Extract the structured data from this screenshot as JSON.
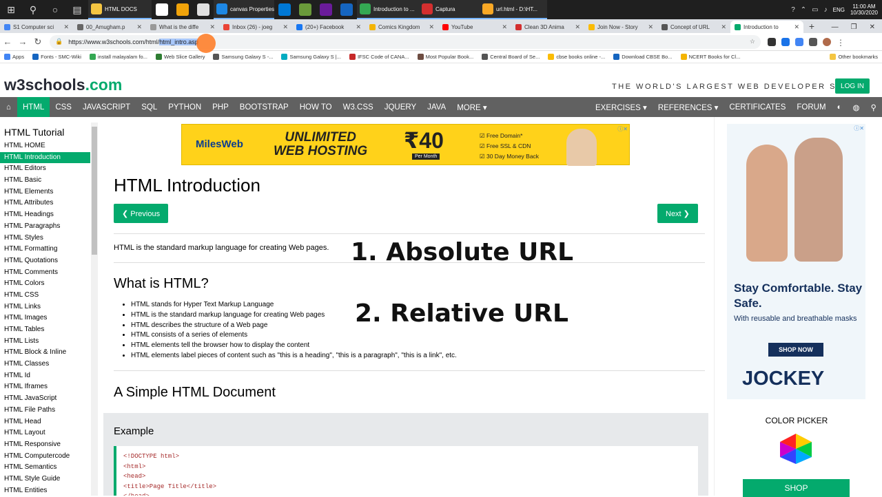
{
  "taskbar": {
    "apps": [
      {
        "label": "HTML DOCS",
        "color": "#f4c542",
        "open": true
      },
      {
        "label": "canvas Properties",
        "color": "#1e88e5",
        "open": true
      },
      {
        "label": "Introduction to ...",
        "color": "#34a853",
        "open": true
      },
      {
        "label": "Captura",
        "color": "#d32f2f",
        "open": true
      },
      {
        "label": "url.html - D:\\HT...",
        "color": "#f9a825",
        "open": true
      }
    ],
    "badge": "99+",
    "lang": "ENG",
    "time": "11:00 AM",
    "date": "10/30/2020"
  },
  "tabs": [
    {
      "title": "S1 Computer sci",
      "color": "#4285f4"
    },
    {
      "title": "00_Amugham.p",
      "color": "#666"
    },
    {
      "title": "What is the diffe",
      "color": "#999"
    },
    {
      "title": "Inbox (26) - joeg",
      "color": "#ea4335"
    },
    {
      "title": "(20+) Facebook",
      "color": "#1877f2"
    },
    {
      "title": "Comics Kingdom",
      "color": "#f4b400"
    },
    {
      "title": "YouTube",
      "color": "#ff0000"
    },
    {
      "title": "Clean 3D Anima",
      "color": "#d32f2f"
    },
    {
      "title": "Join Now - Story",
      "color": "#fbbc05"
    },
    {
      "title": "Concept of URL",
      "color": "#555"
    },
    {
      "title": "Introduction to",
      "color": "#04AA6D",
      "active": true
    }
  ],
  "address": {
    "prefix": "https://www.w3schools.com/html/",
    "selected": "html_intro.asp"
  },
  "bookmarks": [
    {
      "label": "Apps",
      "color": "#4285f4"
    },
    {
      "label": "Fonts - SMC-Wiki",
      "color": "#1565c0"
    },
    {
      "label": "install malayalam fo...",
      "color": "#34a853"
    },
    {
      "label": "Web Slice Gallery",
      "color": "#2e7d32"
    },
    {
      "label": "Samsung Galaxy S -...",
      "color": "#555"
    },
    {
      "label": "Samsung Galaxy S |...",
      "color": "#00acc1"
    },
    {
      "label": "IFSC Code of CANA...",
      "color": "#c62828"
    },
    {
      "label": "Most Popular Book...",
      "color": "#6d4c41"
    },
    {
      "label": "Central Board of Se...",
      "color": "#555"
    },
    {
      "label": "cbse books online -...",
      "color": "#fbbc05"
    },
    {
      "label": "Download CBSE Bo...",
      "color": "#1565c0"
    },
    {
      "label": "NCERT Books for Cl...",
      "color": "#f4b400"
    },
    {
      "label": "Other bookmarks",
      "color": "#f4c542"
    }
  ],
  "site": {
    "logo_main": "w3schools",
    "logo_tld": ".com",
    "tagline": "THE WORLD'S LARGEST WEB DEVELOPER SITE",
    "login": "LOG IN",
    "nav": [
      "HTML",
      "CSS",
      "JAVASCRIPT",
      "SQL",
      "PYTHON",
      "PHP",
      "BOOTSTRAP",
      "HOW TO",
      "W3.CSS",
      "JQUERY",
      "JAVA",
      "MORE ▾"
    ],
    "nav_right": [
      "EXERCISES ▾",
      "REFERENCES ▾",
      "CERTIFICATES",
      "FORUM"
    ]
  },
  "sidebar": {
    "title": "HTML Tutorial",
    "items": [
      "HTML HOME",
      "HTML Introduction",
      "HTML Editors",
      "HTML Basic",
      "HTML Elements",
      "HTML Attributes",
      "HTML Headings",
      "HTML Paragraphs",
      "HTML Styles",
      "HTML Formatting",
      "HTML Quotations",
      "HTML Comments",
      "HTML Colors",
      "HTML CSS",
      "HTML Links",
      "HTML Images",
      "HTML Tables",
      "HTML Lists",
      "HTML Block & Inline",
      "HTML Classes",
      "HTML Id",
      "HTML Iframes",
      "HTML JavaScript",
      "HTML File Paths",
      "HTML Head",
      "HTML Layout",
      "HTML Responsive",
      "HTML Computercode",
      "HTML Semantics",
      "HTML Style Guide",
      "HTML Entities"
    ],
    "active_index": 1
  },
  "ad_top": {
    "brand": "MilesWeb",
    "headline1": "UNLIMITED",
    "headline2": "WEB HOSTING",
    "price": "₹40",
    "per": "Per Month",
    "features": [
      "Free Domain*",
      "Free SSL & CDN",
      "30 Day Money Back"
    ]
  },
  "main": {
    "h1": "HTML Introduction",
    "prev": "❮ Previous",
    "next": "Next ❯",
    "intro": "HTML is the standard markup language for creating Web pages.",
    "h2": "What is HTML?",
    "bullets": [
      "HTML stands for Hyper Text Markup Language",
      "HTML is the standard markup language for creating Web pages",
      "HTML describes the structure of a Web page",
      "HTML consists of a series of elements",
      "HTML elements tell the browser how to display the content",
      "HTML elements label pieces of content such as \"this is a heading\", \"this is a paragraph\", \"this is a link\", etc."
    ],
    "h2b": "A Simple HTML Document",
    "example_label": "Example",
    "code_lines": [
      "<!DOCTYPE html>",
      "<html>",
      "<head>",
      "<title>Page Title</title>",
      "</head>"
    ]
  },
  "overlay": {
    "line1": "1. Absolute URL",
    "line2": "2. Relative URL"
  },
  "right_ad": {
    "headline": "Stay Comfortable. Stay Safe.",
    "sub": "With reusable and breathable masks",
    "cta": "SHOP NOW",
    "brand": "JOCKEY",
    "color_picker": "COLOR PICKER",
    "shop": "SHOP"
  }
}
